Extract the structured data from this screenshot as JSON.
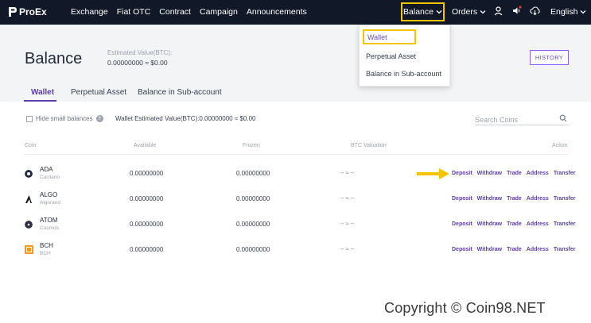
{
  "nav": {
    "brand": "ProEx",
    "links": [
      "Exchange",
      "Fiat OTC",
      "Contract",
      "Campaign",
      "Announcements"
    ],
    "balance": "Balance",
    "orders": "Orders",
    "language": "English",
    "icons": [
      "user-icon",
      "speaker-icon",
      "download-icon"
    ]
  },
  "dropdown": {
    "items": [
      "Wallet",
      "Perpetual Asset",
      "Balance in Sub-account"
    ]
  },
  "header": {
    "title": "Balance",
    "est_label": "Estimated Value(BTC):",
    "est_value": "0.00000000 ≈ $0.00",
    "history_button": "HISTORY"
  },
  "tabs": [
    "Wallet",
    "Perpetual Asset",
    "Balance in Sub-account"
  ],
  "toolbar": {
    "hide_small": "Hide small balances",
    "wallet_est": "Wallet Estimated Value(BTC):0.00000000 ≈ $0.00",
    "search_placeholder": "Search Coins"
  },
  "table": {
    "headers": [
      "Coin",
      "Available",
      "Frozen",
      "BTC Valuation",
      "Action"
    ],
    "actions": [
      "Deposit",
      "Withdraw",
      "Trade",
      "Address",
      "Transfer"
    ],
    "rows": [
      {
        "symbol": "ADA",
        "name": "Cardano",
        "available": "0.00000000",
        "frozen": "0.00000000",
        "btc": "-- ≈ --",
        "color": "#1f2a44"
      },
      {
        "symbol": "ALGO",
        "name": "Algorand",
        "available": "0.00000000",
        "frozen": "0.00000000",
        "btc": "-- ≈ --",
        "color": "#111111"
      },
      {
        "symbol": "ATOM",
        "name": "Cosmos",
        "available": "0.00000000",
        "frozen": "0.00000000",
        "btc": "-- ≈ --",
        "color": "#2e3148"
      },
      {
        "symbol": "BCH",
        "name": "BCH",
        "available": "0.00000000",
        "frozen": "0.00000000",
        "btc": "-- ≈ --",
        "color": "#f7931a"
      }
    ]
  },
  "colors": {
    "nav_bg": "#111827",
    "accent": "#5b3ea8",
    "highlight": "#f5c400"
  },
  "watermark": "Copyright © Coin98.NET"
}
